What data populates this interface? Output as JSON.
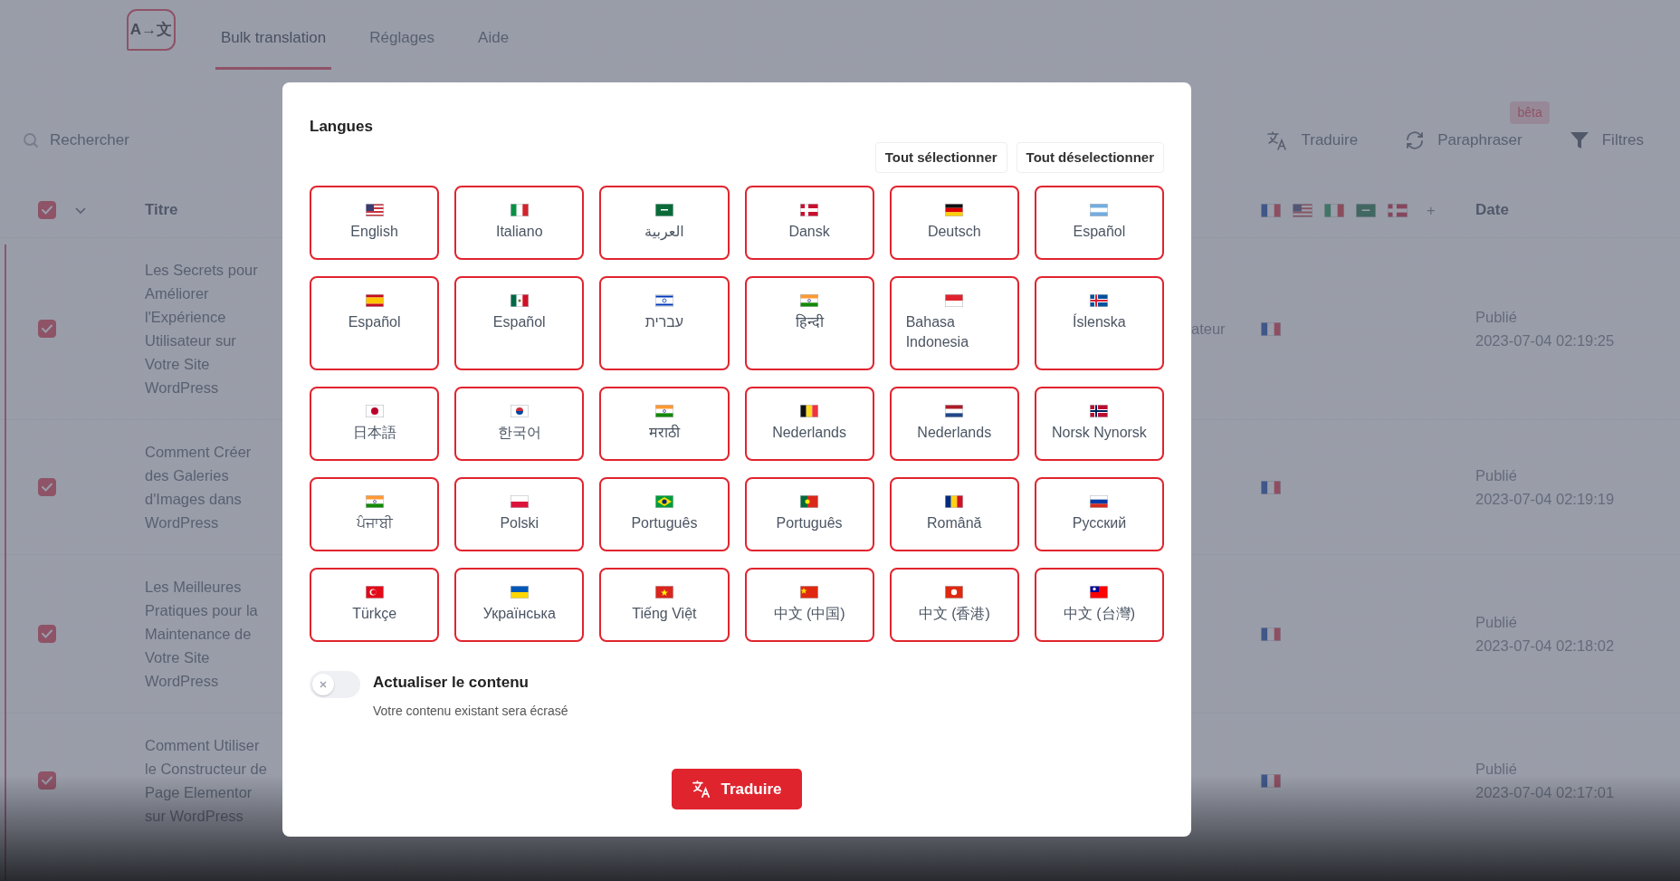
{
  "header": {
    "logo_text": "A→文",
    "tabs": [
      {
        "label": "Bulk translation",
        "selected": true
      },
      {
        "label": "Réglages",
        "selected": false
      },
      {
        "label": "Aide",
        "selected": false
      }
    ]
  },
  "toolbar": {
    "search": {
      "placeholder": "Rechercher"
    },
    "actions": [
      {
        "kind": "translate",
        "label": "Traduire"
      },
      {
        "kind": "paraphrase",
        "label": "Paraphraser",
        "badge": "bêta"
      },
      {
        "kind": "filter",
        "label": "Filtres"
      }
    ]
  },
  "table": {
    "select_all": {
      "checked": true
    },
    "columns": {
      "title": "Titre",
      "language_flags": [
        {
          "kind": "fr"
        },
        {
          "kind": "us"
        },
        {
          "kind": "it"
        },
        {
          "kind": "sa"
        },
        {
          "kind": "dk"
        }
      ],
      "add": "+",
      "date": "Date"
    },
    "rows": [
      {
        "checked": true,
        "title": "Les Secrets pour Améliorer l'Expérience Utilisateur sur Votre Site WordPress",
        "column_3": "ateur",
        "flags": [
          {
            "kind": "fr"
          }
        ],
        "status": "Publié",
        "date": "2023-07-04 02:19:25"
      },
      {
        "checked": true,
        "title": "Comment Créer des Galeries d'Images dans WordPress",
        "flags": [
          {
            "kind": "fr"
          }
        ],
        "status": "Publié",
        "date": "2023-07-04 02:19:19"
      },
      {
        "checked": true,
        "title": "Les Meilleures Pratiques pour la Maintenance de Votre Site WordPress",
        "flags": [
          {
            "kind": "fr"
          }
        ],
        "status": "Publié",
        "date": "2023-07-04 02:18:02"
      },
      {
        "checked": true,
        "title": "Comment Utiliser le Constructeur de Page Elementor sur WordPress",
        "flags": [
          {
            "kind": "fr"
          }
        ],
        "status": "Publié",
        "date": "2023-07-04 02:17:01"
      }
    ]
  },
  "modal": {
    "title": "Langues",
    "buttons": [
      "Tout sélectionner",
      "Tout déselectionner"
    ],
    "languages": [
      {
        "label": "English",
        "kind": "us",
        "selected": true
      },
      {
        "label": "Italiano",
        "kind": "it",
        "selected": true
      },
      {
        "label": "العربية",
        "kind": "sa",
        "selected": true
      },
      {
        "label": "Dansk",
        "kind": "dk",
        "selected": true
      },
      {
        "label": "Deutsch",
        "kind": "de",
        "selected": true
      },
      {
        "label": "Español",
        "kind": "ar",
        "selected": true
      },
      {
        "label": "Español",
        "kind": "es",
        "selected": true
      },
      {
        "label": "Español",
        "kind": "mx",
        "selected": true
      },
      {
        "label": "עברית",
        "kind": "il",
        "selected": true
      },
      {
        "label": "हिन्दी",
        "kind": "in",
        "selected": true
      },
      {
        "label": "Bahasa Indonesia",
        "kind": "id",
        "selected": true
      },
      {
        "label": "Íslenska",
        "kind": "is",
        "selected": true
      },
      {
        "label": "日本語",
        "kind": "jp",
        "selected": true
      },
      {
        "label": "한국어",
        "kind": "kr",
        "selected": true
      },
      {
        "label": "मराठी",
        "kind": "in",
        "selected": true
      },
      {
        "label": "Nederlands",
        "kind": "be",
        "selected": true
      },
      {
        "label": "Nederlands",
        "kind": "nl",
        "selected": true
      },
      {
        "label": "Norsk Nynorsk",
        "kind": "no",
        "selected": true
      },
      {
        "label": "ਪੰਜਾਬੀ",
        "kind": "in",
        "selected": true
      },
      {
        "label": "Polski",
        "kind": "pl",
        "selected": true
      },
      {
        "label": "Português",
        "kind": "br",
        "selected": true
      },
      {
        "label": "Português",
        "kind": "pt",
        "selected": true
      },
      {
        "label": "Română",
        "kind": "ro",
        "selected": true
      },
      {
        "label": "Русский",
        "kind": "ru",
        "selected": true
      },
      {
        "label": "Türkçe",
        "kind": "tr",
        "selected": true
      },
      {
        "label": "Українська",
        "kind": "ua",
        "selected": true
      },
      {
        "label": "Tiếng Việt",
        "kind": "vn",
        "selected": true
      },
      {
        "label": "中文 (中国)",
        "kind": "cn",
        "selected": true
      },
      {
        "label": "中文 (香港)",
        "kind": "hk",
        "selected": true
      },
      {
        "label": "中文 (台灣)",
        "kind": "tw",
        "selected": true
      }
    ],
    "update_content": {
      "on": false,
      "label": "Actualiser le contenu",
      "hint": "Votre contenu existant sera écrasé"
    },
    "submit": "Traduire"
  }
}
